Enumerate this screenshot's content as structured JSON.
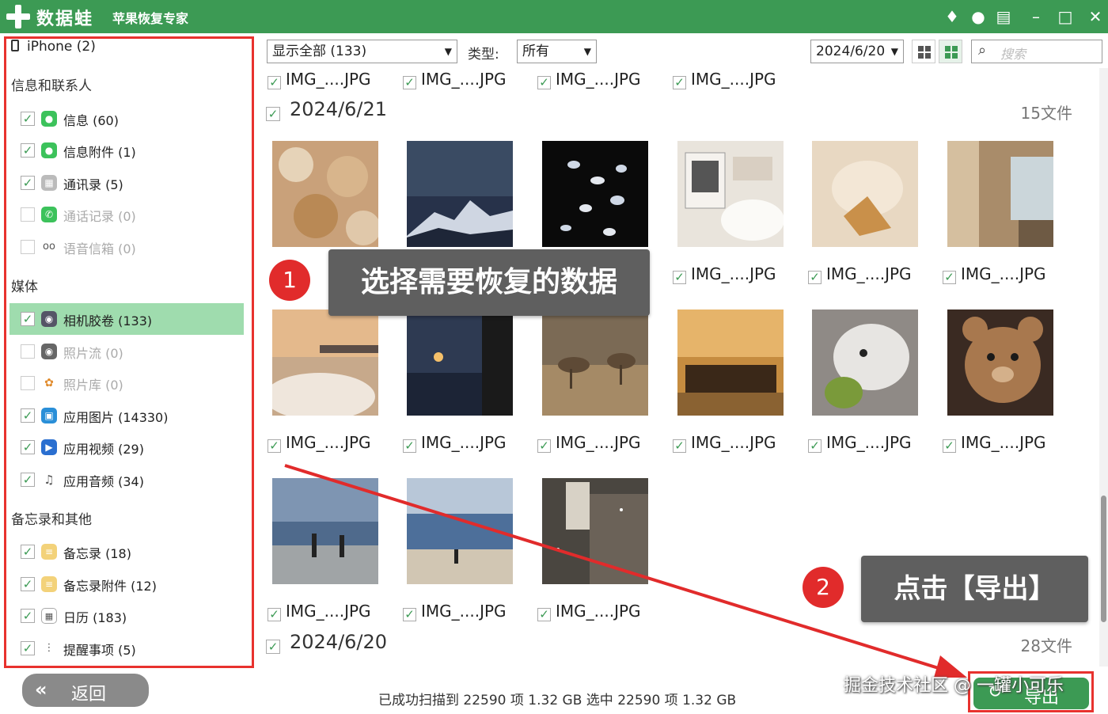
{
  "titlebar": {
    "app_name": "数据蛙",
    "app_sub": "苹果恢复专家"
  },
  "sidebar": {
    "device": "iPhone (2)",
    "sections": [
      {
        "title": "信息和联系人"
      },
      {
        "title": "媒体"
      },
      {
        "title": "备忘录和其他"
      }
    ],
    "items": [
      {
        "label": "信息 (60)",
        "checked": true
      },
      {
        "label": "信息附件 (1)",
        "checked": true
      },
      {
        "label": "通讯录 (5)",
        "checked": true
      },
      {
        "label": "通话记录 (0)",
        "checked": false
      },
      {
        "label": "语音信箱 (0)",
        "checked": false
      },
      {
        "label": "相机胶卷 (133)",
        "checked": true
      },
      {
        "label": "照片流 (0)",
        "checked": false
      },
      {
        "label": "照片库 (0)",
        "checked": false
      },
      {
        "label": "应用图片 (14330)",
        "checked": true
      },
      {
        "label": "应用视频 (29)",
        "checked": true
      },
      {
        "label": "应用音频 (34)",
        "checked": true
      },
      {
        "label": "备忘录 (18)",
        "checked": true
      },
      {
        "label": "备忘录附件 (12)",
        "checked": true
      },
      {
        "label": "日历 (183)",
        "checked": true
      },
      {
        "label": "提醒事项 (5)",
        "checked": true
      }
    ]
  },
  "toolbar": {
    "filter": "显示全部 (133)",
    "type_label": "类型:",
    "type_value": "所有",
    "date_value": "2024/6/20",
    "search_placeholder": "搜索"
  },
  "content": {
    "file_label": "IMG_....JPG",
    "groups": [
      {
        "date": "2024/6/21",
        "count": "15文件"
      },
      {
        "date": "2024/6/20",
        "count": "28文件"
      }
    ]
  },
  "annotations": {
    "step1_number": "1",
    "step1_text": "选择需要恢复的数据",
    "step2_number": "2",
    "step2_text": "点击【导出】"
  },
  "bottom": {
    "back_label": "返回",
    "status": "已成功扫描到 22590 项 1.32 GB   选中 22590 项 1.32 GB",
    "export_label": "导出",
    "watermark": "掘金技术社区 @ 一罐小可乐"
  },
  "colors": {
    "brand_green": "#3c9a54",
    "highlight_red": "#e8322e",
    "active_row": "#9fdcae"
  }
}
